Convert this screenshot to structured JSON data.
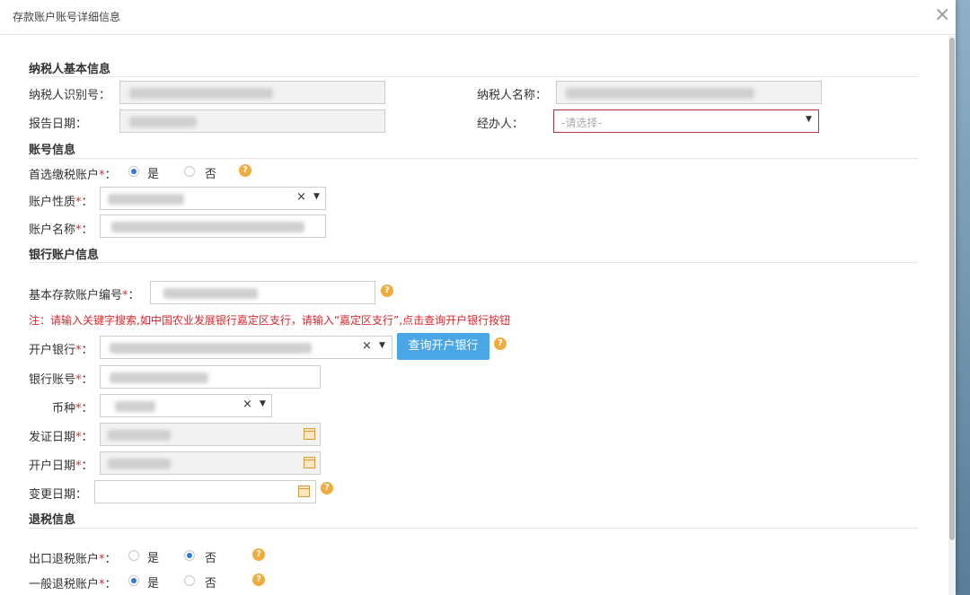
{
  "dialog": {
    "title": "存款账户账号详细信息",
    "close": "×"
  },
  "sections": {
    "basic": "纳税人基本信息",
    "account": "账号信息",
    "bank": "银行账户信息",
    "refund": "退税信息"
  },
  "basic": {
    "taxpayer_id_label": "纳税人识别号：",
    "taxpayer_name_label": "纳税人名称：",
    "report_date_label": "报告日期：",
    "handler_label": "经办人：",
    "handler_placeholder": "-请选择-"
  },
  "account": {
    "preferred_label": "首选缴税账户",
    "nature_label": "账户性质",
    "name_label": "账户名称",
    "yes": "是",
    "no": "否",
    "required_mark": "*",
    "colon": "："
  },
  "bank": {
    "basic_no_label": "基本存款账户编号",
    "note": "注：请输入关键字搜索,如中国农业发展银行嘉定区支行，请输入“嘉定区支行”,点击查询开户银行按钮",
    "open_bank_label": "开户银行",
    "query_button": "查询开户银行",
    "bank_account_label": "银行账号",
    "currency_label": "币种",
    "issue_date_label": "发证日期",
    "open_date_label": "开户日期",
    "change_date_label": "变更日期："
  },
  "refund": {
    "export_label": "出口退税账户",
    "general_label": "一般退税账户",
    "yes": "是",
    "no": "否"
  },
  "icons": {
    "help": "?",
    "clear": "×",
    "caret": "▼"
  }
}
